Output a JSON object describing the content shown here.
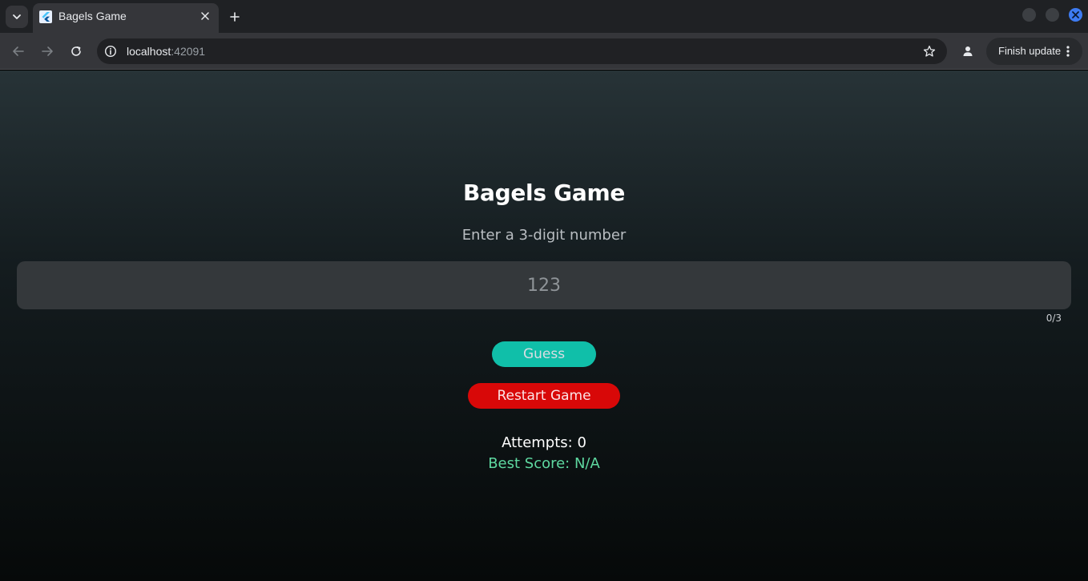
{
  "browser": {
    "tab": {
      "title": "Bagels Game"
    },
    "address": {
      "host": "localhost",
      "port": ":42091"
    },
    "update_button_label": "Finish update",
    "window_controls": {
      "minimize_color": "#3c3f43",
      "maximize_color": "#3c3f43",
      "close_color": "#3d7bf2"
    }
  },
  "game": {
    "title": "Bagels Game",
    "instruction": "Enter a 3-digit number",
    "input": {
      "value": "",
      "placeholder": "123",
      "counter": "0/3"
    },
    "guess_button": {
      "label": "Guess",
      "color": "#10bfa9"
    },
    "restart_button": {
      "label": "Restart Game",
      "color": "#d80808"
    },
    "attempts_text": "Attempts: 0",
    "best_score_text": "Best Score: N/A",
    "best_score_color": "#5ed8a0"
  }
}
